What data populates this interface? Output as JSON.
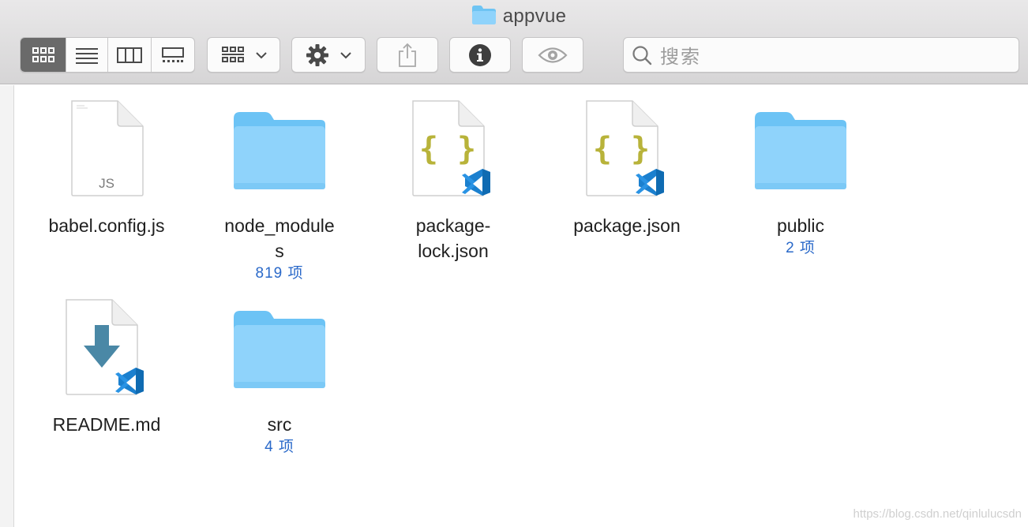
{
  "window": {
    "title": "appvue"
  },
  "toolbar": {
    "view_modes": [
      {
        "name": "icon-view",
        "active": true
      },
      {
        "name": "list-view",
        "active": false
      },
      {
        "name": "column-view",
        "active": false
      },
      {
        "name": "gallery-view",
        "active": false
      }
    ],
    "search": {
      "placeholder": "搜索"
    }
  },
  "files": [
    {
      "name": "babel.config.js",
      "kind": "js-file",
      "icon_label": "JS"
    },
    {
      "name": "node_modules",
      "kind": "folder",
      "count": "819 项"
    },
    {
      "name": "package-lock.json",
      "name_lines": [
        "package-",
        "lock.json"
      ],
      "kind": "json-file",
      "icon_label": "{ }"
    },
    {
      "name": "package.json",
      "kind": "json-file",
      "icon_label": "{ }"
    },
    {
      "name": "public",
      "kind": "folder",
      "count": "2 项"
    },
    {
      "name": "README.md",
      "kind": "md-file"
    },
    {
      "name": "src",
      "kind": "folder",
      "count": "4 项"
    }
  ],
  "watermark": "https://blog.csdn.net/qinlulucsdn",
  "colors": {
    "folder_light": "#8fd3fb",
    "folder_dark": "#6cc3f5",
    "count_text": "#2a69c9",
    "json_brace": "#b8b33a",
    "vscode_blue": "#1b80cf",
    "md_arrow": "#4a88a6"
  }
}
